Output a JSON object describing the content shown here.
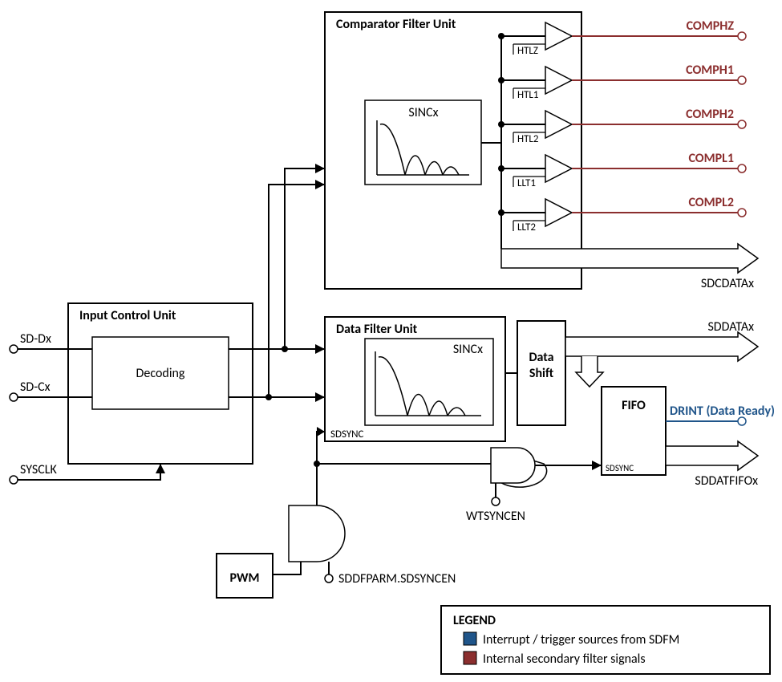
{
  "blocks": {
    "input_control": "Input Control Unit",
    "decoding": "Decoding",
    "comparator": "Comparator Filter Unit",
    "data_filter": "Data Filter Unit",
    "sincx": "SINCx",
    "data_shift": "Data\nShift",
    "fifo": "FIFO",
    "pwm": "PWM"
  },
  "ports": {
    "sd_dx": "SD-Dx",
    "sd_cx": "SD-Cx",
    "sysclk": "SYSCLK",
    "sdsync": "SDSYNC",
    "sdsync2": "SDSYNC",
    "wtsyncen": "WTSYNCEN",
    "sddfparm": "SDDFPARM.SDSYNCEN"
  },
  "comp_labels": {
    "htlz": "HTLZ",
    "htl1": "HTL1",
    "htl2": "HTL2",
    "llt1": "LLT1",
    "llt2": "LLT2"
  },
  "outputs": {
    "comphz": "COMPHZ",
    "comph1": "COMPH1",
    "comph2": "COMPH2",
    "compl1": "COMPL1",
    "compl2": "COMPL2",
    "sdcdatax": "SDCDATAx",
    "sddatax": "SDDATAx",
    "drint": "DRINT (Data Ready)",
    "sddatfifox": "SDDATFIFOx"
  },
  "legend": {
    "title": "LEGEND",
    "item1": "Interrupt / trigger sources from SDFM",
    "item2": "Internal secondary filter signals"
  }
}
